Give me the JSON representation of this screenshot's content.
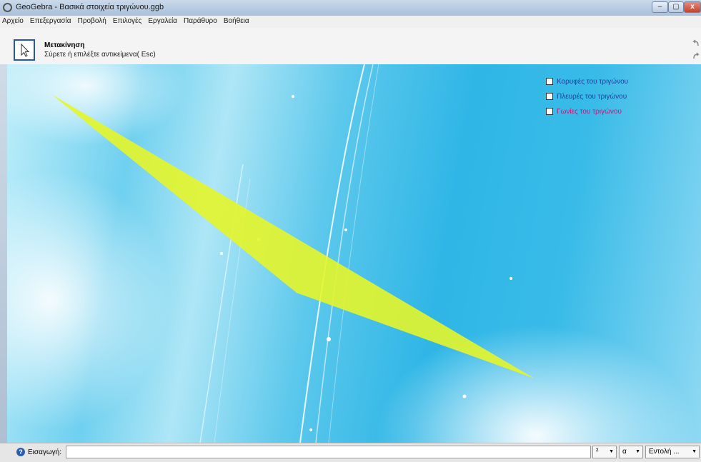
{
  "window": {
    "title": "GeoGebra - Βασικά στοιχεία τριγώνου.ggb",
    "minimize": "–",
    "maximize": "▢",
    "close": "x"
  },
  "menu": [
    "Αρχείο",
    "Επεξεργασία",
    "Προβολή",
    "Επιλογές",
    "Εργαλεία",
    "Παράθυρο",
    "Βοήθεια"
  ],
  "toolbar": {
    "tool_name": "Μετακίνηση",
    "tool_help": "Σύρετε ή επιλέξτε αντικείμενα( Esc)"
  },
  "checkboxes": [
    {
      "label": "Κορυφές του τριγώνου",
      "checked": false,
      "color": "#1f3f9e"
    },
    {
      "label": "Πλευρές του τριγώνου",
      "checked": false,
      "color": "#1f3f9e"
    },
    {
      "label": "Γωνίες του τριγώνου",
      "checked": false,
      "color": "#c2187a"
    }
  ],
  "triangle": {
    "fill": "#e4f52a"
  },
  "inputbar": {
    "label": "Εισαγωγή:",
    "value": "",
    "dropdown1": "²",
    "dropdown2": "α",
    "dropdown3": "Εντολή ..."
  }
}
